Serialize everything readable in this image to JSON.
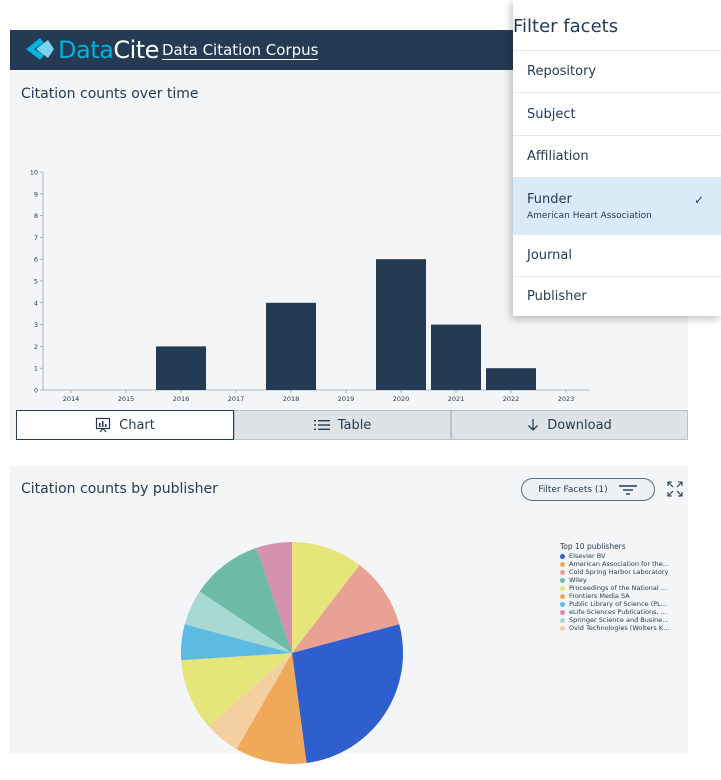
{
  "header": {
    "logo_part1": "Data",
    "logo_part2": "Cite",
    "title": "Data Citation Corpus"
  },
  "panel_over_time": {
    "title": "Citation counts over time"
  },
  "toolbar": {
    "chart_label": "Chart",
    "table_label": "Table",
    "download_label": "Download"
  },
  "panel_by_publisher": {
    "title": "Citation counts by publisher",
    "filter_button_label": "Filter Facets (1)"
  },
  "filter_dropdown": {
    "header": "Filter facets",
    "items": [
      {
        "label": "Repository"
      },
      {
        "label": "Subject"
      },
      {
        "label": "Affiliation"
      },
      {
        "label": "Funder",
        "selected_value": "American Heart Association",
        "checked": true
      },
      {
        "label": "Journal"
      },
      {
        "label": "Publisher"
      }
    ]
  },
  "colors": {
    "navy": "#243b53",
    "logo_accent": "#00b1e2",
    "selected_row": "#d8ebf6"
  },
  "chart_data": [
    {
      "type": "bar",
      "categories": [
        "2014",
        "2015",
        "2016",
        "2017",
        "2018",
        "2019",
        "2020",
        "2021",
        "2022",
        "2023"
      ],
      "values": [
        0,
        0,
        2,
        0,
        4,
        0,
        6,
        3,
        1,
        0
      ],
      "title": "Citation counts over time",
      "ylim": [
        0,
        10
      ],
      "yticks": [
        0,
        1,
        2,
        3,
        4,
        5,
        6,
        7,
        8,
        9,
        10
      ],
      "grid": false,
      "bar_color": "#243b53"
    },
    {
      "type": "pie",
      "title": "Citation counts by publisher",
      "legend_title": "Top 10 publishers",
      "legend_position": "right",
      "slices": [
        {
          "label": "Elsevier BV",
          "color": "#2f5fcf",
          "value": 26
        },
        {
          "label": "American Association for the...",
          "color": "#f0a859",
          "value": 10
        },
        {
          "label": "Cold Spring Harbor Laboratory",
          "color": "#e9a193",
          "value": 10
        },
        {
          "label": "Wiley",
          "color": "#6cbba6",
          "value": 10
        },
        {
          "label": "Proceedings of the National ...",
          "color": "#e6e57a",
          "value": 20
        },
        {
          "label": "Frontiers Media SA",
          "color": "#f3a95a",
          "value": 0
        },
        {
          "label": "Public Library of Science (PL...",
          "color": "#5bbbe0",
          "value": 5
        },
        {
          "label": "eLife Sciences Publications, ...",
          "color": "#d592ad",
          "value": 5
        },
        {
          "label": "Springer Science and Busine...",
          "color": "#a8d8d2",
          "value": 5
        },
        {
          "label": "Ovid Technologies (Wolters K...",
          "color": "#f4d0a1",
          "value": 5
        }
      ]
    }
  ]
}
